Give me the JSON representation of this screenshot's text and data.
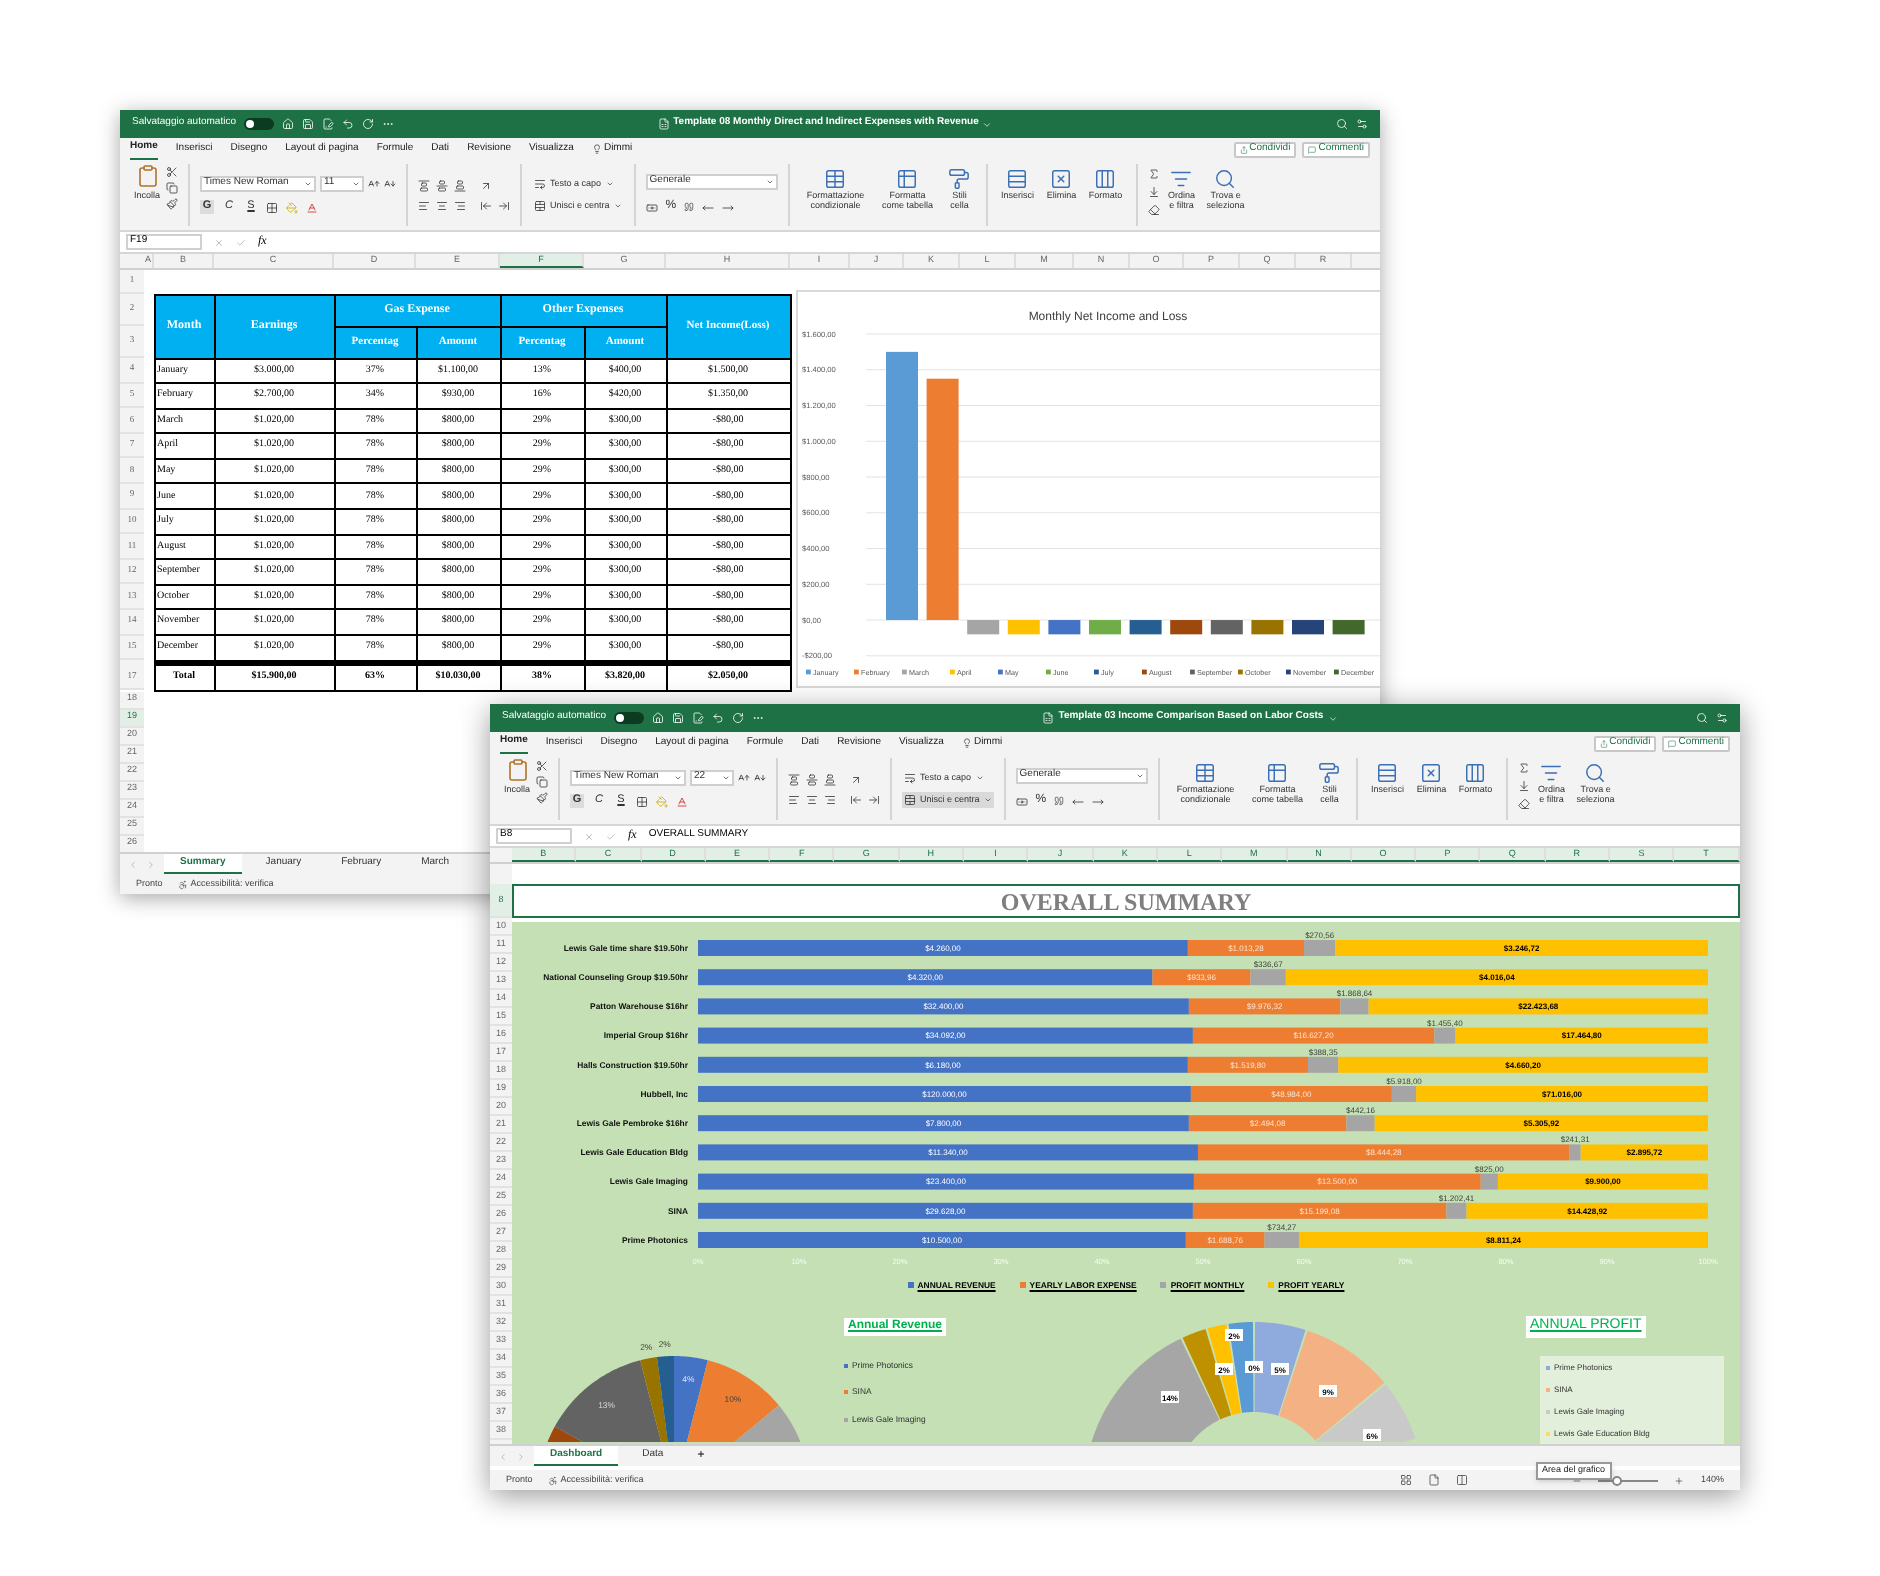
{
  "back_window": {
    "title_bar": {
      "autosave_label": "Salvataggio automatico",
      "autosave_on": false,
      "title": "Template 08 Monthly Direct and Indirect Expenses with Revenue"
    },
    "menu_tabs": [
      {
        "label": "Home",
        "selected": true
      },
      {
        "label": "Inserisci",
        "selected": false
      },
      {
        "label": "Disegno",
        "selected": false
      },
      {
        "label": "Layout di pagina",
        "selected": false
      },
      {
        "label": "Formule",
        "selected": false
      },
      {
        "label": "Dati",
        "selected": false
      },
      {
        "label": "Revisione",
        "selected": false
      },
      {
        "label": "Visualizza",
        "selected": false
      },
      {
        "label": "Dimmi",
        "selected": false
      }
    ],
    "share_button": "Condividi",
    "comments_button": "Commenti",
    "ribbon": {
      "paste": "Incolla",
      "font": "Times New Roman",
      "font_size": "11",
      "bold": "G",
      "italic": "C",
      "underline": "S",
      "wrap_text": {
        "label": "Testo a capo",
        "selected": false
      },
      "merge": {
        "label": "Unisci e centra",
        "selected": false
      },
      "number_format": "Generale",
      "percent": "%",
      "conditional_format": "Formattazione condizionale",
      "format_table": "Formatta come tabella",
      "cell_styles": "Stili cella",
      "insert": "Inserisci",
      "delete": "Elimina",
      "format": "Formato",
      "sort_filter": "Ordina e filtra",
      "find_select": "Trova e seleziona"
    },
    "formula_bar": {
      "name_box": "F19",
      "fx": "fx"
    },
    "columns": [
      {
        "label": "A",
        "selected": false
      },
      {
        "label": "B",
        "selected": false
      },
      {
        "label": "C",
        "selected": false
      },
      {
        "label": "D",
        "selected": false
      },
      {
        "label": "E",
        "selected": false
      },
      {
        "label": "F",
        "selected": true
      },
      {
        "label": "G",
        "selected": false
      },
      {
        "label": "H",
        "selected": false
      },
      {
        "label": "I",
        "selected": false
      },
      {
        "label": "J",
        "selected": false
      },
      {
        "label": "K",
        "selected": false
      },
      {
        "label": "L",
        "selected": false
      },
      {
        "label": "M",
        "selected": false
      },
      {
        "label": "N",
        "selected": false
      },
      {
        "label": "O",
        "selected": false
      },
      {
        "label": "P",
        "selected": false
      },
      {
        "label": "Q",
        "selected": false
      },
      {
        "label": "R",
        "selected": false
      }
    ],
    "sheet": {
      "row_numbers": [
        {
          "label": "1",
          "selected": false
        },
        {
          "label": "2",
          "selected": false
        },
        {
          "label": "3",
          "selected": false
        },
        {
          "label": "4",
          "selected": false
        },
        {
          "label": "5",
          "selected": false
        },
        {
          "label": "6",
          "selected": false
        },
        {
          "label": "7",
          "selected": false
        },
        {
          "label": "8",
          "selected": false
        },
        {
          "label": "9",
          "selected": false
        },
        {
          "label": "10",
          "selected": false
        },
        {
          "label": "11",
          "selected": false
        },
        {
          "label": "12",
          "selected": false
        },
        {
          "label": "13",
          "selected": false
        },
        {
          "label": "14",
          "selected": false
        },
        {
          "label": "15",
          "selected": false
        },
        {
          "label": "17",
          "selected": false
        },
        {
          "label": "18",
          "selected": false
        },
        {
          "label": "19",
          "selected": true
        },
        {
          "label": "20",
          "selected": false
        },
        {
          "label": "21",
          "selected": false
        },
        {
          "label": "22",
          "selected": false
        },
        {
          "label": "23",
          "selected": false
        },
        {
          "label": "24",
          "selected": false
        },
        {
          "label": "25",
          "selected": false
        },
        {
          "label": "26",
          "selected": false
        }
      ],
      "table": {
        "month": "Month",
        "earnings": "Earnings",
        "gas_expense": "Gas Expense",
        "other_expenses": "Other Expenses",
        "net_income": "Net Income(Loss)",
        "sub_headings": [
          "Percentag",
          "Amount",
          "Percentag",
          "Amount"
        ],
        "rows": [
          [
            "January",
            "$3.000,00",
            "37%",
            "$1.100,00",
            "13%",
            "$400,00",
            "$1.500,00"
          ],
          [
            "February",
            "$2.700,00",
            "34%",
            "$930,00",
            "16%",
            "$420,00",
            "$1.350,00"
          ],
          [
            "March",
            "$1.020,00",
            "78%",
            "$800,00",
            "29%",
            "$300,00",
            "-$80,00"
          ],
          [
            "April",
            "$1.020,00",
            "78%",
            "$800,00",
            "29%",
            "$300,00",
            "-$80,00"
          ],
          [
            "May",
            "$1.020,00",
            "78%",
            "$800,00",
            "29%",
            "$300,00",
            "-$80,00"
          ],
          [
            "June",
            "$1.020,00",
            "78%",
            "$800,00",
            "29%",
            "$300,00",
            "-$80,00"
          ],
          [
            "July",
            "$1.020,00",
            "78%",
            "$800,00",
            "29%",
            "$300,00",
            "-$80,00"
          ],
          [
            "August",
            "$1.020,00",
            "78%",
            "$800,00",
            "29%",
            "$300,00",
            "-$80,00"
          ],
          [
            "September",
            "$1.020,00",
            "78%",
            "$800,00",
            "29%",
            "$300,00",
            "-$80,00"
          ],
          [
            "October",
            "$1.020,00",
            "78%",
            "$800,00",
            "29%",
            "$300,00",
            "-$80,00"
          ],
          [
            "November",
            "$1.020,00",
            "78%",
            "$800,00",
            "29%",
            "$300,00",
            "-$80,00"
          ],
          [
            "December",
            "$1.020,00",
            "78%",
            "$800,00",
            "29%",
            "$300,00",
            "-$80,00"
          ]
        ],
        "total": [
          "Total",
          "$15.900,00",
          "63%",
          "$10.030,00",
          "38%",
          "$3.820,00",
          "$2.050,00"
        ]
      },
      "chart": {
        "chart_data": {
          "type": "bar",
          "title": "Monthly Net Income and Loss",
          "grid": true,
          "legend": true,
          "ylim": [
            -200,
            1600
          ],
          "yticks": [
            {
              "value": -200,
              "label": "-$200,00"
            },
            {
              "value": 0,
              "label": "$0,00"
            },
            {
              "value": 200,
              "label": "$200,00"
            },
            {
              "value": 400,
              "label": "$400,00"
            },
            {
              "value": 600,
              "label": "$600,00"
            },
            {
              "value": 800,
              "label": "$800,00"
            },
            {
              "value": 1000,
              "label": "$1.000,00"
            },
            {
              "value": 1200,
              "label": "$1.200,00"
            },
            {
              "value": 1400,
              "label": "$1.400,00"
            },
            {
              "value": 1600,
              "label": "$1.600,00"
            }
          ],
          "series": [
            {
              "name": "January",
              "color": "#5b9bd5",
              "values": [
                1500
              ]
            },
            {
              "name": "February",
              "color": "#ed7d31",
              "values": [
                1350
              ]
            },
            {
              "name": "March",
              "color": "#a5a5a5",
              "values": [
                -80
              ]
            },
            {
              "name": "April",
              "color": "#ffc000",
              "values": [
                -80
              ]
            },
            {
              "name": "May",
              "color": "#4472c4",
              "values": [
                -80
              ]
            },
            {
              "name": "June",
              "color": "#70ad47",
              "values": [
                -80
              ]
            },
            {
              "name": "July",
              "color": "#255e91",
              "values": [
                -80
              ]
            },
            {
              "name": "August",
              "color": "#9e480e",
              "values": [
                -80
              ]
            },
            {
              "name": "September",
              "color": "#636363",
              "values": [
                -80
              ]
            },
            {
              "name": "October",
              "color": "#997300",
              "values": [
                -80
              ]
            },
            {
              "name": "November",
              "color": "#264478",
              "values": [
                -80
              ]
            },
            {
              "name": "December",
              "color": "#43682b",
              "values": [
                -80
              ]
            }
          ]
        }
      }
    },
    "sheet_tabs": [
      {
        "label": "Summary",
        "selected": true
      },
      {
        "label": "January",
        "selected": false
      },
      {
        "label": "February",
        "selected": false
      },
      {
        "label": "March",
        "selected": false
      }
    ],
    "status_bar": {
      "ready": "Pronto",
      "accessibility": "Accessibilità: verifica"
    }
  },
  "front_window": {
    "title_bar": {
      "autosave_label": "Salvataggio automatico",
      "autosave_on": false,
      "title": "Template 03 Income Comparison Based on Labor Costs"
    },
    "menu_tabs": [
      {
        "label": "Home",
        "selected": true
      },
      {
        "label": "Inserisci",
        "selected": false
      },
      {
        "label": "Disegno",
        "selected": false
      },
      {
        "label": "Layout di pagina",
        "selected": false
      },
      {
        "label": "Formule",
        "selected": false
      },
      {
        "label": "Dati",
        "selected": false
      },
      {
        "label": "Revisione",
        "selected": false
      },
      {
        "label": "Visualizza",
        "selected": false
      },
      {
        "label": "Dimmi",
        "selected": false
      }
    ],
    "share_button": "Condividi",
    "comments_button": "Commenti",
    "ribbon": {
      "paste": "Incolla",
      "font": "Times New Roman",
      "font_size": "22",
      "bold": "G",
      "italic": "C",
      "underline": "S",
      "wrap_text": {
        "label": "Testo a capo",
        "selected": false
      },
      "merge": {
        "label": "Unisci e centra",
        "selected": true
      },
      "number_format": "Generale",
      "percent": "%",
      "conditional_format": "Formattazione condizionale",
      "format_table": "Formatta come tabella",
      "cell_styles": "Stili cella",
      "insert": "Inserisci",
      "delete": "Elimina",
      "format": "Formato",
      "sort_filter": "Ordina e filtra",
      "find_select": "Trova e seleziona"
    },
    "formula_bar": {
      "name_box": "B8",
      "fx": "fx",
      "formula": "OVERALL SUMMARY"
    },
    "columns": [
      {
        "label": "B",
        "selected": true
      },
      {
        "label": "C",
        "selected": true
      },
      {
        "label": "D",
        "selected": true
      },
      {
        "label": "E",
        "selected": true
      },
      {
        "label": "F",
        "selected": true
      },
      {
        "label": "G",
        "selected": true
      },
      {
        "label": "H",
        "selected": true
      },
      {
        "label": "I",
        "selected": true
      },
      {
        "label": "J",
        "selected": true
      },
      {
        "label": "K",
        "selected": true
      },
      {
        "label": "L",
        "selected": true
      },
      {
        "label": "M",
        "selected": true
      },
      {
        "label": "N",
        "selected": true
      },
      {
        "label": "O",
        "selected": true
      },
      {
        "label": "P",
        "selected": true
      },
      {
        "label": "Q",
        "selected": true
      },
      {
        "label": "R",
        "selected": true
      },
      {
        "label": "S",
        "selected": true
      },
      {
        "label": "T",
        "selected": true
      }
    ],
    "sheet": {
      "row_numbers": [
        {
          "label": "8",
          "selected": true
        },
        {
          "label": "10",
          "selected": false
        },
        {
          "label": "11",
          "selected": false
        },
        {
          "label": "12",
          "selected": false
        },
        {
          "label": "13",
          "selected": false
        },
        {
          "label": "14",
          "selected": false
        },
        {
          "label": "15",
          "selected": false
        },
        {
          "label": "16",
          "selected": false
        },
        {
          "label": "17",
          "selected": false
        },
        {
          "label": "18",
          "selected": false
        },
        {
          "label": "19",
          "selected": false
        },
        {
          "label": "20",
          "selected": false
        },
        {
          "label": "21",
          "selected": false
        },
        {
          "label": "22",
          "selected": false
        },
        {
          "label": "23",
          "selected": false
        },
        {
          "label": "24",
          "selected": false
        },
        {
          "label": "25",
          "selected": false
        },
        {
          "label": "26",
          "selected": false
        },
        {
          "label": "27",
          "selected": false
        },
        {
          "label": "28",
          "selected": false
        },
        {
          "label": "29",
          "selected": false
        },
        {
          "label": "30",
          "selected": false
        },
        {
          "label": "31",
          "selected": false
        },
        {
          "label": "32",
          "selected": false
        },
        {
          "label": "33",
          "selected": false
        },
        {
          "label": "34",
          "selected": false
        },
        {
          "label": "35",
          "selected": false
        },
        {
          "label": "36",
          "selected": false
        },
        {
          "label": "37",
          "selected": false
        },
        {
          "label": "38",
          "selected": false
        }
      ],
      "title": "OVERALL SUMMARY",
      "summary_chart": {
        "chart_data": {
          "type": "bar",
          "orientation": "horizontal",
          "stacked": true,
          "xlim": [
            0,
            1
          ],
          "categories": [
            "Lewis Gale time share $19.50hr",
            "National Counseling Group $19.50hr",
            "Patton Warehouse $16hr",
            "Imperial Group $16hr",
            "Halls Construction $19.50hr",
            "Hubbell, Inc",
            "Lewis Gale Pembroke $16hr",
            "Lewis Gale Education Bldg",
            "Lewis Gale Imaging",
            "SINA",
            "Prime Photonics"
          ],
          "xticks": [
            {
              "value": 0,
              "label": "0%"
            },
            {
              "value": 0.1,
              "label": "10%"
            },
            {
              "value": 0.2,
              "label": "20%"
            },
            {
              "value": 0.3,
              "label": "30%"
            },
            {
              "value": 0.4,
              "label": "40%"
            },
            {
              "value": 0.5,
              "label": "50%"
            },
            {
              "value": 0.6,
              "label": "60%"
            },
            {
              "value": 0.7,
              "label": "70%"
            },
            {
              "value": 0.8,
              "label": "80%"
            },
            {
              "value": 0.9,
              "label": "90%"
            },
            {
              "value": 1,
              "label": "100%"
            }
          ],
          "series": [
            {
              "name": "ANNUAL REVENUE",
              "color": "#4472c4",
              "values": [
                0.485,
                0.45,
                0.486,
                0.49,
                0.485,
                0.488,
                0.486,
                0.495,
                0.491,
                0.49,
                0.483
              ]
            },
            {
              "name": "YEARLY LABOR EXPENSE",
              "color": "#ed7d31",
              "values": [
                0.115,
                0.097,
                0.15,
                0.239,
                0.119,
                0.199,
                0.156,
                0.368,
                0.284,
                0.251,
                0.078
              ]
            },
            {
              "name": "PROFIT MONTHLY",
              "color": "#a5a5a5",
              "values": [
                0.031,
                0.035,
                0.028,
                0.021,
                0.03,
                0.024,
                0.028,
                0.011,
                0.017,
                0.02,
                0.034
              ]
            },
            {
              "name": "PROFIT YEARLY",
              "color": "#ffc000",
              "values": [
                0.369,
                0.418,
                0.336,
                0.25,
                0.366,
                0.289,
                0.33,
                0.126,
                0.208,
                0.239,
                0.405
              ]
            }
          ],
          "value_labels": [
            [
              "$4.260,00",
              "$4.320,00",
              "$32.400,00",
              "$34.092,00",
              "$6.180,00",
              "$120.000,00",
              "$7.800,00",
              "$11.340,00",
              "$23.400,00",
              "$29.628,00",
              "$10.500,00"
            ],
            [
              "$1.013,28",
              "$933,96",
              "$9.976,32",
              "$16.627,20",
              "$1.519,80",
              "$48.984,00",
              "$2.494,08",
              "$8.444,28",
              "$13.500,00",
              "$15.199,08",
              "$1.688,76"
            ],
            [
              "$270,56",
              "$336,67",
              "$1.868,64",
              "$1.455,40",
              "$388,35",
              "$5.918,00",
              "$442,16",
              "$241,31",
              "$825,00",
              "$1.202,41",
              "$734,27"
            ],
            [
              "$3.246,72",
              "$4.016,04",
              "$22.423,68",
              "$17.464,80",
              "$4.660,20",
              "$71.016,00",
              "$5.305,92",
              "$2.895,72",
              "$9.900,00",
              "$14.428,92",
              "$8.811,24"
            ]
          ]
        }
      },
      "annual_revenue": {
        "title": "Annual Revenue",
        "pie_labels": [
          "2%",
          "2%",
          "4%",
          "10%",
          "13%"
        ],
        "legend": [
          {
            "label": "Prime Photonics",
            "color": "#4472c4"
          },
          {
            "label": "SINA",
            "color": "#ed7d31"
          },
          {
            "label": "Lewis Gale Imaging",
            "color": "#a5a5a5"
          }
        ]
      },
      "annual_profit": {
        "title": "ANNUAL PROFIT",
        "donut_labels": [
          "2%",
          "2%",
          "0%",
          "5%",
          "9%",
          "14%",
          "6%"
        ],
        "legend": [
          {
            "label": "Prime Photonics",
            "color": "#8faadc"
          },
          {
            "label": "SINA",
            "color": "#f4b183"
          },
          {
            "label": "Lewis Gale Imaging",
            "color": "#c9c9c9"
          },
          {
            "label": "Lewis Gale Education Bldg",
            "color": "#ffd966"
          }
        ]
      }
    },
    "sheet_tabs": [
      {
        "label": "Dashboard",
        "selected": true
      },
      {
        "label": "Data",
        "selected": false
      }
    ],
    "add_sheet": "+",
    "tooltip": "Area del grafico",
    "status_bar": {
      "ready": "Pronto",
      "accessibility": "Accessibilità: verifica",
      "zoom": "140%",
      "zoom_slider": {
        "level": 0.3
      }
    }
  }
}
